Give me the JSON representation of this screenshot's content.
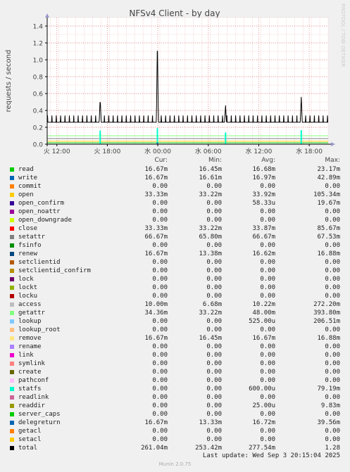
{
  "chart_data": {
    "type": "line",
    "title": "NFSv4 Client - by day",
    "ylabel": "requests / second",
    "side_label": "RRDTOOL / TOBI OETIKER",
    "ylim": [
      0,
      1.5
    ],
    "yticks": [
      0.0,
      0.2,
      0.4,
      0.6,
      0.8,
      1.0,
      1.2,
      1.4
    ],
    "ytick_labels": [
      "0.0",
      "0.2",
      "0.4",
      "0.6",
      "0.8",
      "1.0",
      "1.2",
      "1.4"
    ],
    "xticks": [
      "火 12:00",
      "火 18:00",
      "水 00:00",
      "水 06:00",
      "水 12:00",
      "水 18:00"
    ],
    "xrange_hours": [
      -33.4,
      0
    ],
    "xtick_hours": [
      -32.25,
      -26.25,
      -20.25,
      -14.25,
      -8.25,
      -2.25
    ],
    "total_series": {
      "name": "total",
      "baseline": 0.26,
      "tooth_peak": 0.34,
      "tooth_period_hours": 0.52,
      "spikes": [
        {
          "hours": -27.1,
          "value": 0.54
        },
        {
          "hours": -20.3,
          "value": 1.27
        },
        {
          "hours": -12.2,
          "value": 0.46
        },
        {
          "hours": -3.2,
          "value": 0.56
        }
      ]
    },
    "legend_header": {
      "cur": "Cur:",
      "min": "Min:",
      "avg": "Avg:",
      "max": "Max:"
    },
    "series": [
      {
        "name": "read",
        "color": "#00cc00",
        "cur": "16.67m",
        "min": "16.45m",
        "avg": "16.68m",
        "max": "23.17m"
      },
      {
        "name": "write",
        "color": "#0066b3",
        "cur": "16.67m",
        "min": "16.61m",
        "avg": "16.97m",
        "max": "42.89m"
      },
      {
        "name": "commit",
        "color": "#ff8000",
        "cur": "0.00",
        "min": "0.00",
        "avg": "0.00",
        "max": "0.00"
      },
      {
        "name": "open",
        "color": "#ffcc00",
        "cur": "33.33m",
        "min": "33.22m",
        "avg": "33.92m",
        "max": "105.34m"
      },
      {
        "name": "open_confirm",
        "color": "#330099",
        "cur": "0.00",
        "min": "0.00",
        "avg": "58.33u",
        "max": "19.67m"
      },
      {
        "name": "open_noattr",
        "color": "#990099",
        "cur": "0.00",
        "min": "0.00",
        "avg": "0.00",
        "max": "0.00"
      },
      {
        "name": "open_downgrade",
        "color": "#ccff00",
        "cur": "0.00",
        "min": "0.00",
        "avg": "0.00",
        "max": "0.00"
      },
      {
        "name": "close",
        "color": "#ff0000",
        "cur": "33.33m",
        "min": "33.22m",
        "avg": "33.87m",
        "max": "85.67m"
      },
      {
        "name": "setattr",
        "color": "#808080",
        "cur": "66.67m",
        "min": "65.80m",
        "avg": "66.67m",
        "max": "67.53m"
      },
      {
        "name": "fsinfo",
        "color": "#008f00",
        "cur": "0.00",
        "min": "0.00",
        "avg": "0.00",
        "max": "0.00"
      },
      {
        "name": "renew",
        "color": "#00487d",
        "cur": "16.67m",
        "min": "13.38m",
        "avg": "16.62m",
        "max": "16.88m"
      },
      {
        "name": "setclientid",
        "color": "#b35a00",
        "cur": "0.00",
        "min": "0.00",
        "avg": "0.00",
        "max": "0.00"
      },
      {
        "name": "setclientid_confirm",
        "color": "#b38f00",
        "cur": "0.00",
        "min": "0.00",
        "avg": "0.00",
        "max": "0.00"
      },
      {
        "name": "lock",
        "color": "#6b006b",
        "cur": "0.00",
        "min": "0.00",
        "avg": "0.00",
        "max": "0.00"
      },
      {
        "name": "lockt",
        "color": "#8fb300",
        "cur": "0.00",
        "min": "0.00",
        "avg": "0.00",
        "max": "0.00"
      },
      {
        "name": "locku",
        "color": "#b30000",
        "cur": "0.00",
        "min": "0.00",
        "avg": "0.00",
        "max": "0.00"
      },
      {
        "name": "access",
        "color": "#bebebe",
        "cur": "10.00m",
        "min": "6.68m",
        "avg": "10.22m",
        "max": "272.20m"
      },
      {
        "name": "getattr",
        "color": "#80ff80",
        "cur": "34.36m",
        "min": "33.22m",
        "avg": "48.00m",
        "max": "393.80m"
      },
      {
        "name": "lookup",
        "color": "#80c9ff",
        "cur": "0.00",
        "min": "0.00",
        "avg": "525.00u",
        "max": "206.51m"
      },
      {
        "name": "lookup_root",
        "color": "#ffc080",
        "cur": "0.00",
        "min": "0.00",
        "avg": "0.00",
        "max": "0.00"
      },
      {
        "name": "remove",
        "color": "#ffe680",
        "cur": "16.67m",
        "min": "16.45m",
        "avg": "16.67m",
        "max": "16.88m"
      },
      {
        "name": "rename",
        "color": "#aa80ff",
        "cur": "0.00",
        "min": "0.00",
        "avg": "0.00",
        "max": "0.00"
      },
      {
        "name": "link",
        "color": "#ee00cc",
        "cur": "0.00",
        "min": "0.00",
        "avg": "0.00",
        "max": "0.00"
      },
      {
        "name": "symlink",
        "color": "#ff8080",
        "cur": "0.00",
        "min": "0.00",
        "avg": "0.00",
        "max": "0.00"
      },
      {
        "name": "create",
        "color": "#666600",
        "cur": "0.00",
        "min": "0.00",
        "avg": "0.00",
        "max": "0.00"
      },
      {
        "name": "pathconf",
        "color": "#ffbfff",
        "cur": "0.00",
        "min": "0.00",
        "avg": "0.00",
        "max": "0.00"
      },
      {
        "name": "statfs",
        "color": "#00ffcc",
        "cur": "0.00",
        "min": "0.00",
        "avg": "600.00u",
        "max": "79.19m"
      },
      {
        "name": "readlink",
        "color": "#cc6699",
        "cur": "0.00",
        "min": "0.00",
        "avg": "0.00",
        "max": "0.00"
      },
      {
        "name": "readdir",
        "color": "#999900",
        "cur": "0.00",
        "min": "0.00",
        "avg": "25.00u",
        "max": "9.83m"
      },
      {
        "name": "server_caps",
        "color": "#00cc00",
        "cur": "0.00",
        "min": "0.00",
        "avg": "0.00",
        "max": "0.00"
      },
      {
        "name": "delegreturn",
        "color": "#0066b3",
        "cur": "16.67m",
        "min": "13.33m",
        "avg": "16.72m",
        "max": "39.56m"
      },
      {
        "name": "getacl",
        "color": "#ff8000",
        "cur": "0.00",
        "min": "0.00",
        "avg": "0.00",
        "max": "0.00"
      },
      {
        "name": "setacl",
        "color": "#ffcc00",
        "cur": "0.00",
        "min": "0.00",
        "avg": "0.00",
        "max": "0.00"
      },
      {
        "name": "total",
        "color": "#000000",
        "cur": "261.04m",
        "min": "253.42m",
        "avg": "277.54m",
        "max": "1.28"
      }
    ],
    "last_update": "Last update: Wed Sep  3 20:15:04 2025",
    "footer": "Munin 2.0.75"
  }
}
